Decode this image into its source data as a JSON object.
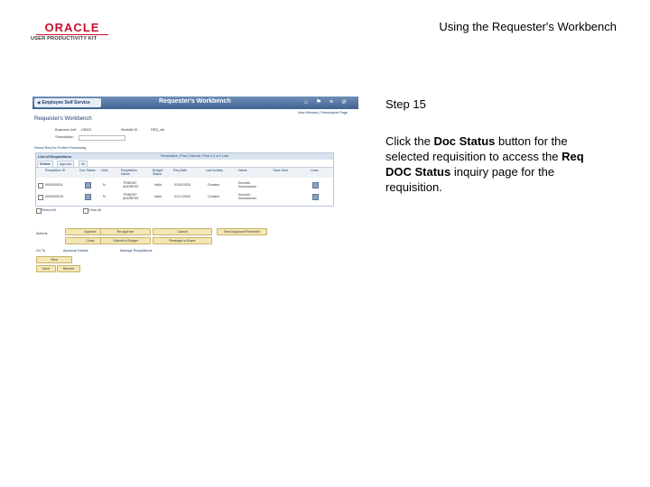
{
  "header": {
    "logo_brand": "ORACLE",
    "logo_product": "USER PRODUCTIVITY KIT",
    "title": "Using the Requester's Workbench"
  },
  "colors": {
    "brand_red": "#c8102e",
    "nav_blue": "#3f6290",
    "button_gold": "#f3e7b3"
  },
  "screenshot": {
    "nav_tab": "Employee Self Service",
    "window_title": "Requester's Workbench",
    "nav_icons": [
      "home-icon",
      "favorites-icon",
      "menu-icon",
      "actions-icon"
    ],
    "links": "New Window | Personalize Page",
    "page_heading": "Requester's Workbench",
    "business_unit_label": "Business Unit",
    "business_unit_value": "US001",
    "worklist_label": "Worklist ID",
    "worklist_value": "REQ_wb",
    "description_label": "*Description",
    "description_value": "",
    "select_link": "Select Req for Further Processing",
    "grid": {
      "title": "List of Requisitions",
      "nav": "Personalize | Find | View All | First 1-2 of 2 Last",
      "tabs": [
        "Details",
        "Approve",
        "All"
      ],
      "columns": [
        "Requisition ID",
        "Doc Status",
        "Hold",
        "Requisition Name",
        "Budget Status",
        "Req Date",
        "Last Activity",
        "Name",
        "Track Sent",
        "Lines"
      ],
      "rows": [
        {
          "id": "0000000011",
          "hold": "N",
          "name": "TRIDENT ADDRESS",
          "budget": "Valid",
          "date": "01/02/2020",
          "activity": "Created",
          "requester": "Kenneth Schumacher"
        },
        {
          "id": "0000000015",
          "hold": "N",
          "name": "TRIDENT ADDRESS",
          "budget": "Valid",
          "date": "01/17/2020",
          "activity": "Created",
          "requester": "Kenneth Schumacher"
        }
      ]
    },
    "select_all": "Select All",
    "clear_all": "Clear All",
    "actions_label": "Actions",
    "buttons": [
      "Approve",
      "Re-approve",
      "Cancel",
      "Send Approval Reminder",
      "Close",
      "Submit to Budget",
      "Reassign to Buyer"
    ],
    "goto_label": "Go To",
    "goto_links": [
      "Approval Details",
      "Manage Requisitions"
    ],
    "view_label": "View",
    "save_label": "Save",
    "refresh_label": "Refresh"
  },
  "step": {
    "number": "Step 15",
    "text_1": "Click the ",
    "bold_1": "Doc Status",
    "text_2": " button for the selected requisition to access the ",
    "bold_2": "Req DOC Status",
    "text_3": " inquiry page for the requisition."
  }
}
